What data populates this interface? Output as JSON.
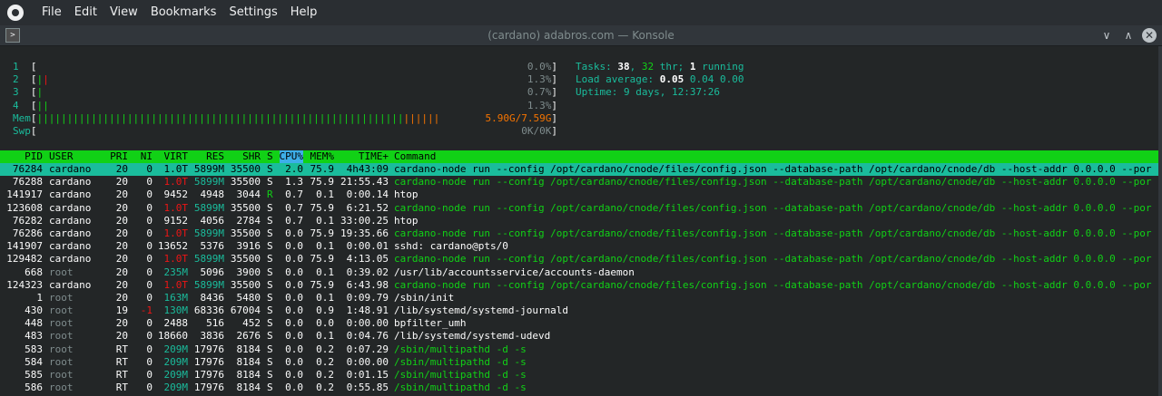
{
  "menubar": {
    "items": [
      "File",
      "Edit",
      "View",
      "Bookmarks",
      "Settings",
      "Help"
    ]
  },
  "window": {
    "title": "(cardano) adabros.com — Konsole",
    "terminal_icon_glyph": ">",
    "minimize_glyph": "∨",
    "maximize_glyph": "∧",
    "close_glyph": "✕"
  },
  "meters": {
    "cpus": [
      {
        "label": "1",
        "percent": "0.0%",
        "green_bars": "",
        "red_bars": ""
      },
      {
        "label": "2",
        "percent": "1.3%",
        "green_bars": "|",
        "red_bars": "|"
      },
      {
        "label": "3",
        "percent": "0.7%",
        "green_bars": "|",
        "red_bars": ""
      },
      {
        "label": "4",
        "percent": "1.3%",
        "green_bars": "||",
        "red_bars": ""
      }
    ],
    "mem": {
      "label": "Mem",
      "value": "5.90G/7.59G",
      "fill_fraction": 0.777
    },
    "swp": {
      "label": "Swp",
      "value": "0K/0K"
    }
  },
  "summary": {
    "tasks_label": "Tasks: ",
    "tasks": "38",
    "thr": "32",
    "thr_label": " thr; ",
    "running": "1",
    "running_label": " running",
    "load_label": "Load average: ",
    "load1": "0.05",
    "load5": "0.04",
    "load15": "0.00",
    "uptime_label": "Uptime: ",
    "uptime": "9 days, 12:37:26"
  },
  "table": {
    "headers": {
      "pid": "PID",
      "user": "USER",
      "pri": "PRI",
      "ni": "NI",
      "virt": "VIRT",
      "res": "RES",
      "shr": "SHR",
      "s": "S",
      "cpu": "CPU%",
      "mem": "MEM%",
      "time": "TIME+",
      "command": "Command"
    },
    "rows": [
      {
        "pid": "76284",
        "user": "cardano",
        "pri": "20",
        "ni": "0",
        "virt": "1.0T",
        "res": "5899M",
        "shr": "35500",
        "s": "S",
        "cpu": "2.0",
        "mem": "75.9",
        "time": "4h43:09",
        "command": "cardano-node run --config /opt/cardano/cnode/files/config.json --database-path /opt/cardano/cnode/db --host-addr 0.0.0.0 --por",
        "selected": true,
        "thread": false
      },
      {
        "pid": "76288",
        "user": "cardano",
        "pri": "20",
        "ni": "0",
        "virt": "1.0T",
        "res": "5899M",
        "shr": "35500",
        "s": "S",
        "cpu": "1.3",
        "mem": "75.9",
        "time": "21:55.43",
        "command": "cardano-node run --config /opt/cardano/cnode/files/config.json --database-path /opt/cardano/cnode/db --host-addr 0.0.0.0 --por",
        "selected": false,
        "thread": true
      },
      {
        "pid": "141917",
        "user": "cardano",
        "pri": "20",
        "ni": "0",
        "virt": "9452",
        "res": "4948",
        "shr": "3044",
        "s": "R",
        "cpu": "0.7",
        "mem": "0.1",
        "time": "0:00.14",
        "command": "htop",
        "selected": false,
        "thread": false
      },
      {
        "pid": "123608",
        "user": "cardano",
        "pri": "20",
        "ni": "0",
        "virt": "1.0T",
        "res": "5899M",
        "shr": "35500",
        "s": "S",
        "cpu": "0.7",
        "mem": "75.9",
        "time": "6:21.52",
        "command": "cardano-node run --config /opt/cardano/cnode/files/config.json --database-path /opt/cardano/cnode/db --host-addr 0.0.0.0 --por",
        "selected": false,
        "thread": true
      },
      {
        "pid": "76282",
        "user": "cardano",
        "pri": "20",
        "ni": "0",
        "virt": "9152",
        "res": "4056",
        "shr": "2784",
        "s": "S",
        "cpu": "0.7",
        "mem": "0.1",
        "time": "33:00.25",
        "command": "htop",
        "selected": false,
        "thread": false
      },
      {
        "pid": "76286",
        "user": "cardano",
        "pri": "20",
        "ni": "0",
        "virt": "1.0T",
        "res": "5899M",
        "shr": "35500",
        "s": "S",
        "cpu": "0.0",
        "mem": "75.9",
        "time": "19:35.66",
        "command": "cardano-node run --config /opt/cardano/cnode/files/config.json --database-path /opt/cardano/cnode/db --host-addr 0.0.0.0 --por",
        "selected": false,
        "thread": true
      },
      {
        "pid": "141907",
        "user": "cardano",
        "pri": "20",
        "ni": "0",
        "virt": "13652",
        "res": "5376",
        "shr": "3916",
        "s": "S",
        "cpu": "0.0",
        "mem": "0.1",
        "time": "0:00.01",
        "command": "sshd: cardano@pts/0",
        "selected": false,
        "thread": false
      },
      {
        "pid": "129482",
        "user": "cardano",
        "pri": "20",
        "ni": "0",
        "virt": "1.0T",
        "res": "5899M",
        "shr": "35500",
        "s": "S",
        "cpu": "0.0",
        "mem": "75.9",
        "time": "4:13.05",
        "command": "cardano-node run --config /opt/cardano/cnode/files/config.json --database-path /opt/cardano/cnode/db --host-addr 0.0.0.0 --por",
        "selected": false,
        "thread": true
      },
      {
        "pid": "668",
        "user": "root",
        "pri": "20",
        "ni": "0",
        "virt": "235M",
        "res": "5096",
        "shr": "3900",
        "s": "S",
        "cpu": "0.0",
        "mem": "0.1",
        "time": "0:39.02",
        "command": "/usr/lib/accountsservice/accounts-daemon",
        "selected": false,
        "thread": false
      },
      {
        "pid": "124323",
        "user": "cardano",
        "pri": "20",
        "ni": "0",
        "virt": "1.0T",
        "res": "5899M",
        "shr": "35500",
        "s": "S",
        "cpu": "0.0",
        "mem": "75.9",
        "time": "6:43.98",
        "command": "cardano-node run --config /opt/cardano/cnode/files/config.json --database-path /opt/cardano/cnode/db --host-addr 0.0.0.0 --por",
        "selected": false,
        "thread": true
      },
      {
        "pid": "1",
        "user": "root",
        "pri": "20",
        "ni": "0",
        "virt": "163M",
        "res": "8436",
        "shr": "5480",
        "s": "S",
        "cpu": "0.0",
        "mem": "0.1",
        "time": "0:09.79",
        "command": "/sbin/init",
        "selected": false,
        "thread": false
      },
      {
        "pid": "430",
        "user": "root",
        "pri": "19",
        "ni": "-1",
        "virt": "130M",
        "res": "68336",
        "shr": "67004",
        "s": "S",
        "cpu": "0.0",
        "mem": "0.9",
        "time": "1:48.91",
        "command": "/lib/systemd/systemd-journald",
        "selected": false,
        "thread": false
      },
      {
        "pid": "448",
        "user": "root",
        "pri": "20",
        "ni": "0",
        "virt": "2488",
        "res": "516",
        "shr": "452",
        "s": "S",
        "cpu": "0.0",
        "mem": "0.0",
        "time": "0:00.00",
        "command": "bpfilter_umh",
        "selected": false,
        "thread": false
      },
      {
        "pid": "483",
        "user": "root",
        "pri": "20",
        "ni": "0",
        "virt": "18660",
        "res": "3836",
        "shr": "2676",
        "s": "S",
        "cpu": "0.0",
        "mem": "0.1",
        "time": "0:04.76",
        "command": "/lib/systemd/systemd-udevd",
        "selected": false,
        "thread": false
      },
      {
        "pid": "583",
        "user": "root",
        "pri": "RT",
        "ni": "0",
        "virt": "209M",
        "res": "17976",
        "shr": "8184",
        "s": "S",
        "cpu": "0.0",
        "mem": "0.2",
        "time": "0:07.29",
        "command": "/sbin/multipathd -d -s",
        "selected": false,
        "thread": true
      },
      {
        "pid": "584",
        "user": "root",
        "pri": "RT",
        "ni": "0",
        "virt": "209M",
        "res": "17976",
        "shr": "8184",
        "s": "S",
        "cpu": "0.0",
        "mem": "0.2",
        "time": "0:00.00",
        "command": "/sbin/multipathd -d -s",
        "selected": false,
        "thread": true
      },
      {
        "pid": "585",
        "user": "root",
        "pri": "RT",
        "ni": "0",
        "virt": "209M",
        "res": "17976",
        "shr": "8184",
        "s": "S",
        "cpu": "0.0",
        "mem": "0.2",
        "time": "0:01.15",
        "command": "/sbin/multipathd -d -s",
        "selected": false,
        "thread": true
      },
      {
        "pid": "586",
        "user": "root",
        "pri": "RT",
        "ni": "0",
        "virt": "209M",
        "res": "17976",
        "shr": "8184",
        "s": "S",
        "cpu": "0.0",
        "mem": "0.2",
        "time": "0:55.85",
        "command": "/sbin/multipathd -d -s",
        "selected": false,
        "thread": true
      }
    ]
  }
}
